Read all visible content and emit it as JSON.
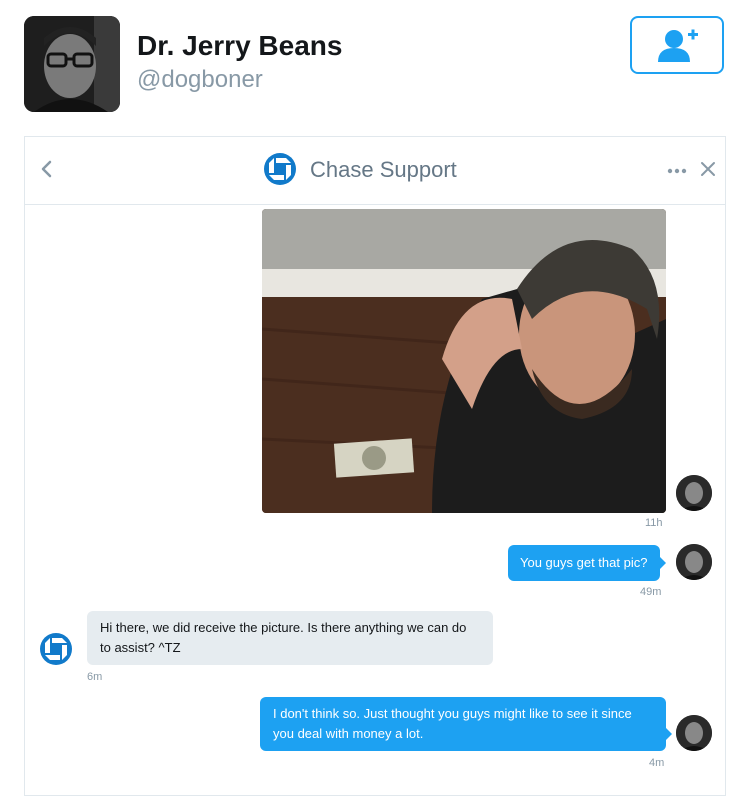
{
  "profile": {
    "display_name": "Dr. Jerry Beans",
    "handle": "@dogboner",
    "follow_icon": "add-user-icon"
  },
  "conversation": {
    "title": "Chase Support",
    "icons": [
      "chevron-left-icon",
      "chase-logo-icon",
      "more-icon",
      "close-icon"
    ]
  },
  "messages": [
    {
      "direction": "out",
      "type": "photo",
      "timestamp": "11h"
    },
    {
      "direction": "out",
      "type": "text",
      "text": "You guys get that pic?",
      "timestamp": "49m"
    },
    {
      "direction": "in",
      "type": "text",
      "text": "Hi there, we did receive the picture. Is there anything we can do to assist? ^TZ",
      "timestamp": "6m"
    },
    {
      "direction": "out",
      "type": "text",
      "text": "I don't think so. Just thought you guys might like to see it since you deal with money a lot.",
      "timestamp": "4m"
    }
  ],
  "colors": {
    "accent": "#1da1f2",
    "chase_blue": "#117aca",
    "incoming_bubble": "#e6ecf0",
    "muted_text": "#8899a6"
  }
}
